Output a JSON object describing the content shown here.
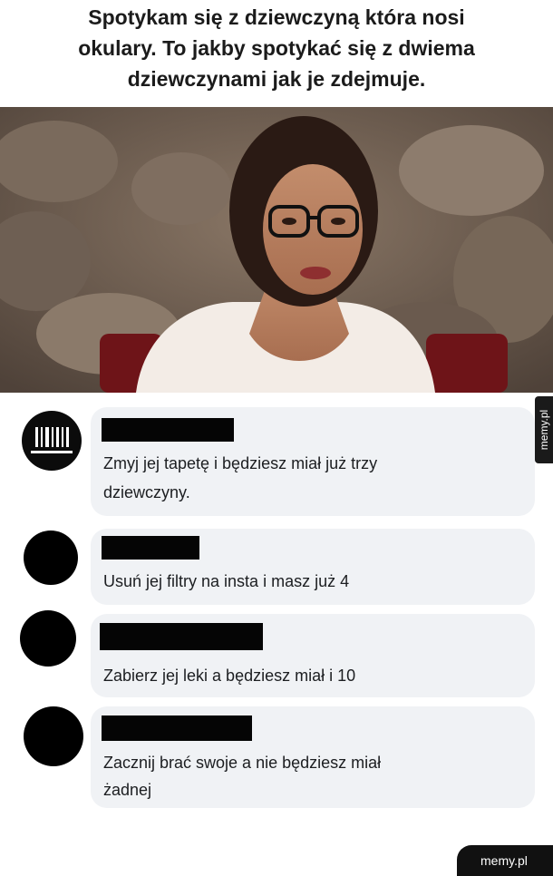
{
  "caption": {
    "line1": "Spotykam się z dziewczyną która nosi",
    "line2": "okulary. To jakby spotykać się z dwiema",
    "line3": "dziewczynami jak je zdejmuje."
  },
  "comments": [
    {
      "text_line1": "Zmyj jej tapetę i będziesz miał już trzy",
      "text_line2": "dziewczyny."
    },
    {
      "text_line1": "Usuń jej filtry na insta i masz już 4"
    },
    {
      "text_line1": "Zabierz jej leki a będziesz miał i 10"
    },
    {
      "text_line1": "Zacznij brać swoje a nie będziesz miał",
      "text_line2": "żadnej"
    }
  ],
  "watermark": {
    "side": "memy.pl",
    "bottom": "memy.pl"
  },
  "colors": {
    "bubble": "#f0f2f5",
    "text": "#1c1e21",
    "caption": "#1b1b1b"
  }
}
